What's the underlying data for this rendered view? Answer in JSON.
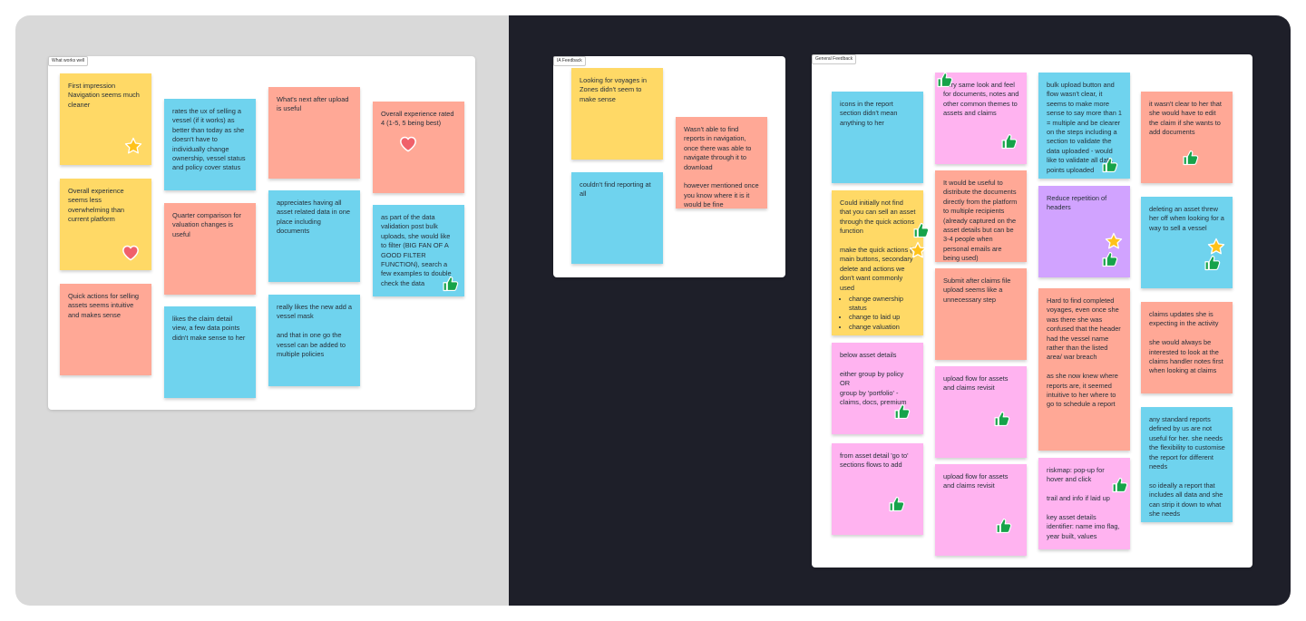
{
  "sections": {
    "works_well": {
      "label": "What works well",
      "notes": [
        {
          "text": "First impression\nNavigation seems much cleaner"
        },
        {
          "text": "Overall experience seems less overwhelming than current platform"
        },
        {
          "text": "Quick actions for selling assets seems intuitive and makes sense"
        },
        {
          "text": "rates the ux of selling a vessel (if it works) as better than today as she doesn't have to individually change ownership, vessel status and policy cover status"
        },
        {
          "text": "Quarter comparison for valuation changes is useful"
        },
        {
          "text": "likes the claim detail view, a few data points didn't make sense to her"
        },
        {
          "text": "What's next after upload is useful"
        },
        {
          "text": "appreciates having all asset related data in one place including documents"
        },
        {
          "text": "really likes the new add a vessel mask\n\nand that in one go the vessel can be added to multiple policies"
        },
        {
          "text": "Overall experience rated 4 (1-5, 5 being best)"
        },
        {
          "text": "as part of the data validation post bulk uploads, she would like to filter (BIG FAN OF A GOOD FILTER FUNCTION), search a few examples to double check the data"
        }
      ]
    },
    "ia_feedback": {
      "label": "IA Feedback",
      "notes": [
        {
          "text": "Looking for voyages in Zones didn't seem to make sense"
        },
        {
          "text": "couldn't find reporting at all"
        },
        {
          "text": "Wasn't able to find reports in navigation, once there was able to navigate through it to download\n\nhowever mentioned once you know where it is it would be fine"
        }
      ]
    },
    "general_feedback": {
      "label": "General Feedback",
      "notes": [
        {
          "text": "icons in the report section didn't mean anything to her"
        },
        {
          "text": "Could initially not find that you can sell an asset through the quick actions function\n\nmake the quick actions (3 main buttons, secondary delete and actions we don't want commonly used",
          "bullets": [
            "change ownership status",
            "change to laid up",
            "change valuation"
          ]
        },
        {
          "text": "below asset details\n\neither group by policy\nOR\ngroup by 'portfolio' - claims, docs, premium"
        },
        {
          "text": "from asset detail 'go to' sections flows to add"
        },
        {
          "text": "Very same look and feel for documents, notes and other common themes to assets and claims"
        },
        {
          "text": "It would be useful to distribute the documents directly from the platform to multiple recipients (already captured on the asset details but can be 3-4 people when personal emails are being used)"
        },
        {
          "text": "Submit after claims file upload seems like a unnecessary step"
        },
        {
          "text": "upload flow for assets and claims revisit"
        },
        {
          "text": "upload flow for assets and claims revisit"
        },
        {
          "text": "bulk upload button and flow wasn't clear, it seems to make more sense to say more than 1 = multiple and be clearer on the steps including a section to validate the data uploaded - would like to validate all data points uploaded"
        },
        {
          "text": "Reduce repetition of headers"
        },
        {
          "text": "Hard to find completed voyages, even once she was there she was confused that the header had the vessel name rather than the listed area/ war breach\n\nas she now knew where reports are, it seemed intuitive to her where to go to schedule a report"
        },
        {
          "text": "riskmap: pop-up for hover and click\n\ntrail and info if laid up\n\nkey asset details identifier: name imo flag, year built, values"
        },
        {
          "text": "it wasn't clear to her that she would have to edit the claim if she wants to add documents"
        },
        {
          "text": "deleting an asset threw her off when looking for a way to sell a vessel"
        },
        {
          "text": "claims updates she is expecting in the activity\n\nshe would always be interested to look at the claims handler notes first when looking at claims"
        },
        {
          "text": "any standard reports defined by us are not useful for her. she needs the flexibility to customise the report for different needs\n\nso ideally a report that includes all data and she can strip it down to what she needs"
        }
      ]
    }
  },
  "reactions": {
    "star_icon": "star-icon",
    "heart_icon": "heart-icon",
    "thumbs_up_icon": "thumbs-up-icon"
  },
  "colors": {
    "yellow": "#ffd966",
    "blue": "#6fd3ee",
    "salmon": "#ffa896",
    "pink": "#ffb3f0",
    "purple": "#d1a3ff",
    "left_background": "#d9d9d9",
    "right_background": "#1e1f29",
    "star": "#ffc21a",
    "heart": "#f0606a",
    "thumb": "#16a34a"
  }
}
